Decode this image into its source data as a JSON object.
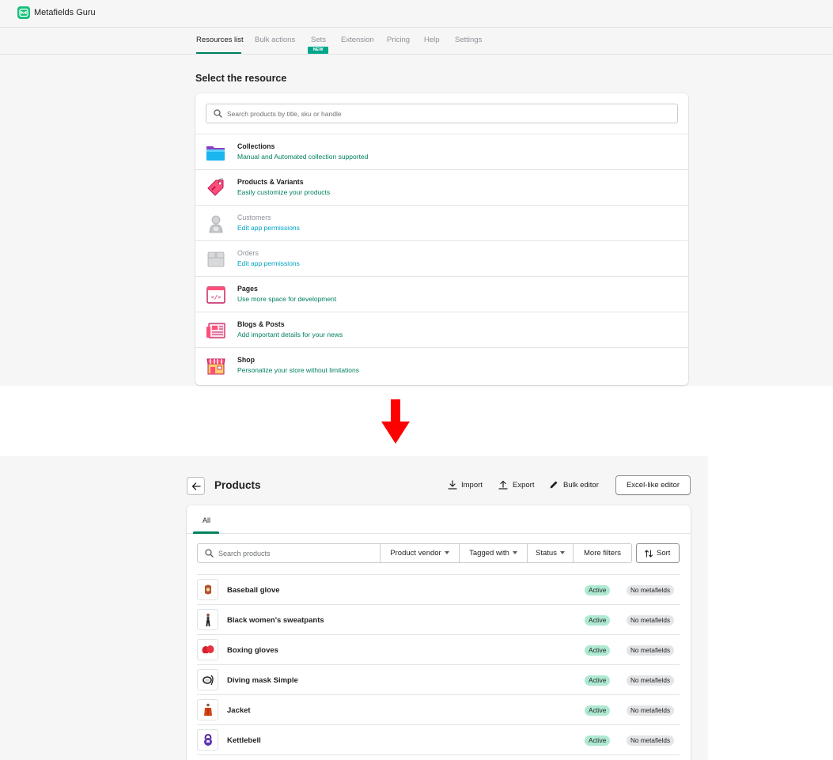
{
  "app": {
    "name": "Metafields Guru",
    "brand_color": "#16c07a",
    "logo_icon": "metafields-guru-logo"
  },
  "nav": {
    "tabs": [
      {
        "label": "Resources list",
        "active": true
      },
      {
        "label": "Bulk actions"
      },
      {
        "label": "Sets",
        "badge": "NEW"
      },
      {
        "label": "Extension"
      },
      {
        "label": "Pricing"
      },
      {
        "label": "Help"
      },
      {
        "label": "Settings"
      }
    ],
    "accent_color": "#008060"
  },
  "resources": {
    "title": "Select the resource",
    "search_placeholder": "Search products by title, sku or handle",
    "items": [
      {
        "title": "Collections",
        "subtitle": "Manual and Automated collection supported",
        "icon": "folder-icon",
        "enabled": true
      },
      {
        "title": "Products & Variants",
        "subtitle": "Easily customize your products",
        "icon": "price-tag-icon",
        "enabled": true
      },
      {
        "title": "Customers",
        "subtitle": "Edit app permissions",
        "icon": "customer-icon",
        "enabled": false
      },
      {
        "title": "Orders",
        "subtitle": "Edit app permissions",
        "icon": "box-icon",
        "enabled": false
      },
      {
        "title": "Pages",
        "subtitle": "Use more space for development",
        "icon": "code-page-icon",
        "enabled": true
      },
      {
        "title": "Blogs & Posts",
        "subtitle": "Add important details for your news",
        "icon": "newspaper-icon",
        "enabled": true
      },
      {
        "title": "Shop",
        "subtitle": "Personalize your store without limitations",
        "icon": "storefront-icon",
        "enabled": true
      }
    ]
  },
  "transition_arrow": {
    "icon": "down-arrow-icon",
    "color": "#ff0000"
  },
  "products_page": {
    "title": "Products",
    "actions": {
      "import": "Import",
      "export": "Export",
      "bulk_editor": "Bulk editor",
      "excel_editor": "Excel-like editor"
    },
    "tabs": [
      {
        "label": "All",
        "active": true
      }
    ],
    "search_placeholder": "Search products",
    "filters": {
      "vendor": "Product vendor",
      "tagged": "Tagged with",
      "status": "Status",
      "more": "More filters",
      "sort": "Sort"
    },
    "rows": [
      {
        "name": "Baseball glove",
        "status": "Active",
        "metafields": "No metafields",
        "thumb_icon": "baseball-glove-icon"
      },
      {
        "name": "Black women's sweatpants",
        "status": "Active",
        "metafields": "No metafields",
        "thumb_icon": "sweatpants-icon"
      },
      {
        "name": "Boxing gloves",
        "status": "Active",
        "metafields": "No metafields",
        "thumb_icon": "boxing-gloves-icon"
      },
      {
        "name": "Diving mask Simple",
        "status": "Active",
        "metafields": "No metafields",
        "thumb_icon": "diving-mask-icon"
      },
      {
        "name": "Jacket",
        "status": "Active",
        "metafields": "No metafields",
        "thumb_icon": "jacket-icon"
      },
      {
        "name": "Kettlebell",
        "status": "Active",
        "metafields": "No metafields",
        "thumb_icon": "kettlebell-icon"
      }
    ],
    "status_color": "#aee9d1",
    "metafield_badge_color": "#e4e5e7"
  }
}
